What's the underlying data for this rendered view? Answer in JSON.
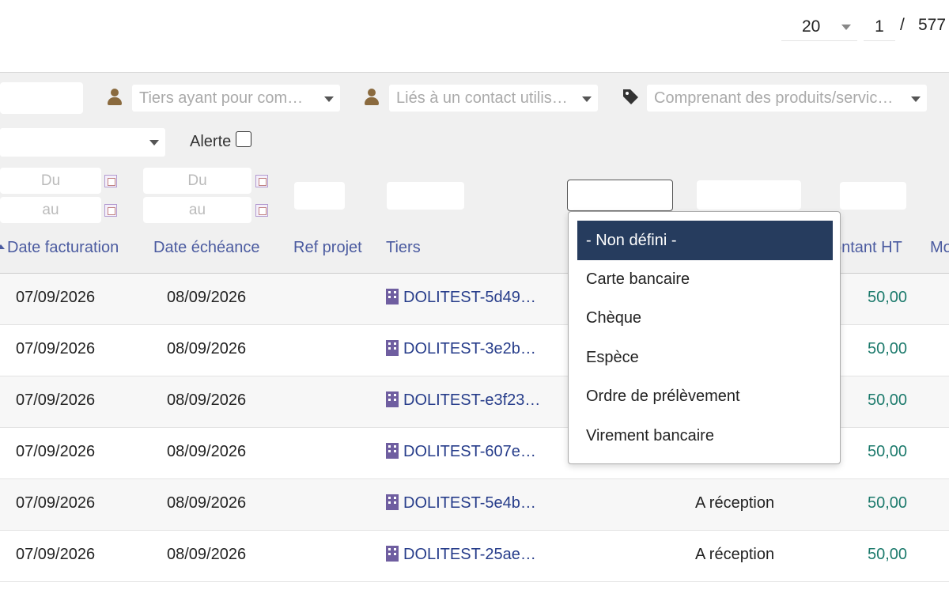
{
  "pagination": {
    "per_page": "20",
    "page": "1",
    "separator": "/",
    "total_pages": "577"
  },
  "filters": {
    "thirdparty_sales_rep_placeholder": "Tiers ayant pour comm…",
    "linked_contact_placeholder": "Liés à un contact utilisa…",
    "products_placeholder": "Comprenant des produits/service…",
    "alert_label": "Alerte",
    "date_from_placeholder": "Du",
    "date_to_placeholder": "au"
  },
  "columns": {
    "date_invoice": "Date facturation",
    "date_due": "Date échéance",
    "ref_project": "Ref projet",
    "thirdparty": "Tiers",
    "amount_ht": "ontant HT",
    "amount_next": "Mo"
  },
  "rows": [
    {
      "date_invoice": "07/09/2026",
      "date_due": "08/09/2026",
      "thirdparty": "DOLITEST-5d49…",
      "payment_term": "",
      "amount": "50,00"
    },
    {
      "date_invoice": "07/09/2026",
      "date_due": "08/09/2026",
      "thirdparty": "DOLITEST-3e2b…",
      "payment_term": "",
      "amount": "50,00"
    },
    {
      "date_invoice": "07/09/2026",
      "date_due": "08/09/2026",
      "thirdparty": "DOLITEST-e3f23…",
      "payment_term": "",
      "amount": "50,00"
    },
    {
      "date_invoice": "07/09/2026",
      "date_due": "08/09/2026",
      "thirdparty": "DOLITEST-607e…",
      "payment_term": "",
      "amount": "50,00"
    },
    {
      "date_invoice": "07/09/2026",
      "date_due": "08/09/2026",
      "thirdparty": "DOLITEST-5e4b…",
      "payment_term": "A réception",
      "amount": "50,00"
    },
    {
      "date_invoice": "07/09/2026",
      "date_due": "08/09/2026",
      "thirdparty": "DOLITEST-25ae…",
      "payment_term": "A réception",
      "amount": "50,00"
    }
  ],
  "payment_mode_dropdown": {
    "options": [
      "- Non défini -",
      "Carte bancaire",
      "Chèque",
      "Espèce",
      "Ordre de prélèvement",
      "Virement bancaire"
    ],
    "selected_index": 0
  },
  "icons": {
    "user": "user-icon",
    "tag": "tag-icon",
    "calendar": "calendar-icon",
    "company": "building-icon",
    "caret": "caret-down-icon"
  },
  "colors": {
    "link": "#263c8a",
    "header_text": "#4b5ba0",
    "amount": "#1c7a6c",
    "selected_option_bg": "#263c5e",
    "user_icon": "#8a6a3e",
    "building_icon": "#6f5ea0"
  }
}
